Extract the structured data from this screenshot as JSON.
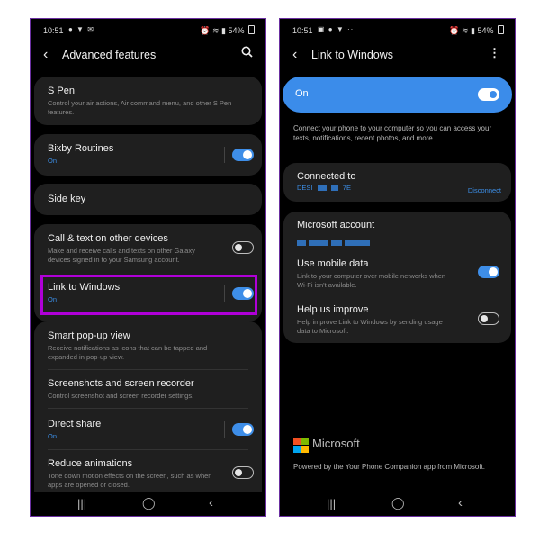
{
  "left": {
    "status": {
      "time": "10:51",
      "battery": "54%"
    },
    "appbar": {
      "title": "Advanced features"
    },
    "items": {
      "spen": {
        "title": "S Pen",
        "subtitle": "Control your air actions, Air command menu, and other S Pen features."
      },
      "bixby": {
        "title": "Bixby Routines",
        "status": "On"
      },
      "sidekey": {
        "title": "Side key"
      },
      "calltext": {
        "title": "Call & text on other devices",
        "subtitle": "Make and receive calls and texts on other Galaxy devices signed in to your Samsung account."
      },
      "link": {
        "title": "Link to Windows",
        "status": "On"
      },
      "popup": {
        "title": "Smart pop-up view",
        "subtitle": "Receive notifications as icons that can be tapped and expanded in pop-up view."
      },
      "screenshots": {
        "title": "Screenshots and screen recorder",
        "subtitle": "Control screenshot and screen recorder settings."
      },
      "direct": {
        "title": "Direct share",
        "status": "On"
      },
      "reduce": {
        "title": "Reduce animations",
        "subtitle": "Tone down motion effects on the screen, such as when apps are opened or closed."
      }
    }
  },
  "right": {
    "status": {
      "time": "10:51",
      "battery": "54%"
    },
    "appbar": {
      "title": "Link to Windows"
    },
    "on_label": "On",
    "description": "Connect your phone to your computer so you can access your texts, notifications, recent photos, and more.",
    "connected": {
      "title": "Connected to",
      "device_prefix": "DESI",
      "device_suffix": "7E",
      "disconnect": "Disconnect"
    },
    "account": {
      "title": "Microsoft account"
    },
    "mobile": {
      "title": "Use mobile data",
      "subtitle": "Link to your computer over mobile networks when Wi-Fi isn't available."
    },
    "improve": {
      "title": "Help us improve",
      "subtitle": "Help improve Link to Windows by sending usage data to Microsoft."
    },
    "brand": "Microsoft",
    "powered": "Powered by the Your Phone Companion app from Microsoft."
  },
  "colors": {
    "accent": "#3b8cea",
    "highlight": "#b000d8",
    "ms_red": "#f25022",
    "ms_green": "#7fba00",
    "ms_blue": "#00a4ef",
    "ms_yellow": "#ffb900"
  },
  "icons": [
    "back-arrow-icon",
    "search-icon",
    "more-vert-icon",
    "recents-icon",
    "home-icon",
    "nav-back-icon"
  ]
}
